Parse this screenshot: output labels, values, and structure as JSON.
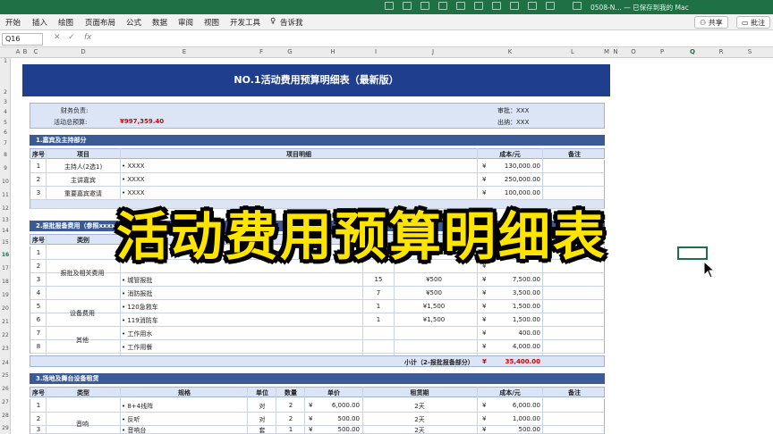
{
  "ribbon": {
    "title": "0508-N… — 已保存到我的 Mac"
  },
  "menu": {
    "items": [
      "开始",
      "插入",
      "绘图",
      "页面布局",
      "公式",
      "数据",
      "审阅",
      "视图",
      "开发工具",
      "告诉我"
    ],
    "share": "共享",
    "comment": "批注"
  },
  "formula_bar": {
    "namebox": "Q16",
    "fx": "fx"
  },
  "columns": [
    "A",
    "B",
    "C",
    "D",
    "E",
    "F",
    "G",
    "H",
    "I",
    "J",
    "K",
    "L",
    "M",
    "N",
    "O",
    "P",
    "Q",
    "R",
    "S"
  ],
  "row_numbers": [
    "1",
    "2",
    "3",
    "4",
    "5",
    "6",
    "7",
    "8",
    "9",
    "10",
    "11",
    "12",
    "13",
    "14",
    "15",
    "16",
    "17",
    "18",
    "19",
    "20",
    "21",
    "22",
    "23",
    "24",
    "25",
    "26",
    "27",
    "28",
    "29"
  ],
  "doc": {
    "title": "NO.1活动费用预算明细表（最新版）",
    "finance_label": "财务负责:",
    "budget_label": "活动总预算:",
    "budget_value": "¥997,359.40",
    "approve_label": "审批：XXX",
    "cashier_label": "出纳：XXX"
  },
  "sec1": {
    "title": "1.嘉宾及主持部分",
    "headers": [
      "序号",
      "项目",
      "项目明细",
      "成本/元",
      "备注"
    ],
    "rows": [
      {
        "no": "1",
        "item": "主持人(2选1)",
        "detail": "• XXXX",
        "cur": "¥",
        "cost": "130,000.00"
      },
      {
        "no": "2",
        "item": "主讲嘉宾",
        "detail": "• XXXX",
        "cur": "¥",
        "cost": "250,000.00"
      },
      {
        "no": "3",
        "item": "重要嘉宾邀请",
        "detail": "• XXXX",
        "cur": "¥",
        "cost": "100,000.00"
      }
    ]
  },
  "sec2": {
    "title": "2.报批报备费用（参照xxxx年…",
    "headers": [
      "序号",
      "类别"
    ],
    "rows": [
      {
        "no": "1",
        "detail": "•",
        "qty": "",
        "price": "",
        "cur": "",
        "cost": ""
      },
      {
        "no": "2",
        "detail": "",
        "qty": "",
        "price": "",
        "cur": "¥",
        "cost": ""
      },
      {
        "no": "3",
        "detail": "• 城管报批",
        "qty": "15",
        "price": "¥500",
        "cur": "¥",
        "cost": "7,500.00"
      },
      {
        "no": "4",
        "detail": "• 消防报批",
        "qty": "7",
        "price": "¥500",
        "cur": "¥",
        "cost": "3,500.00"
      },
      {
        "no": "5",
        "detail": "• 120急救车",
        "qty": "1",
        "price": "¥1,500",
        "cur": "¥",
        "cost": "1,500.00"
      },
      {
        "no": "6",
        "detail": "• 119消防车",
        "qty": "1",
        "price": "¥1,500",
        "cur": "¥",
        "cost": "1,500.00"
      },
      {
        "no": "7",
        "detail": "• 工作用水",
        "qty": "",
        "price": "",
        "cur": "¥",
        "cost": "400.00"
      },
      {
        "no": "8",
        "detail": "• 工作用餐",
        "qty": "",
        "price": "",
        "cur": "¥",
        "cost": "4,000.00"
      }
    ],
    "groups": [
      "报批及相关费用",
      "设备费用",
      "其他"
    ],
    "subtotal_label": "小计（2-报批报备部分）",
    "subtotal_cur": "¥",
    "subtotal_value": "35,400.00"
  },
  "sec3": {
    "title": "3.场地及舞台设备租赁",
    "headers": [
      "序号",
      "类型",
      "规格",
      "单位",
      "数量",
      "单价",
      "租赁期",
      "成本/元",
      "备注"
    ],
    "rows": [
      {
        "no": "1",
        "spec": "• 8+4线阵",
        "unit": "对",
        "qty": "2",
        "cur1": "¥",
        "price": "6,000.00",
        "period": "2天",
        "cur2": "¥",
        "cost": "6,000.00"
      },
      {
        "no": "2",
        "spec": "• 反听",
        "unit": "对",
        "qty": "2",
        "cur1": "¥",
        "price": "500.00",
        "period": "2天",
        "cur2": "¥",
        "cost": "1,000.00"
      },
      {
        "no": "3",
        "spec": "• 音响台",
        "unit": "套",
        "qty": "1",
        "cur1": "¥",
        "price": "500.00",
        "period": "2天",
        "cur2": "¥",
        "cost": "500.00"
      }
    ],
    "group": "音响"
  },
  "overlay_text": "活动费用预算明细表"
}
